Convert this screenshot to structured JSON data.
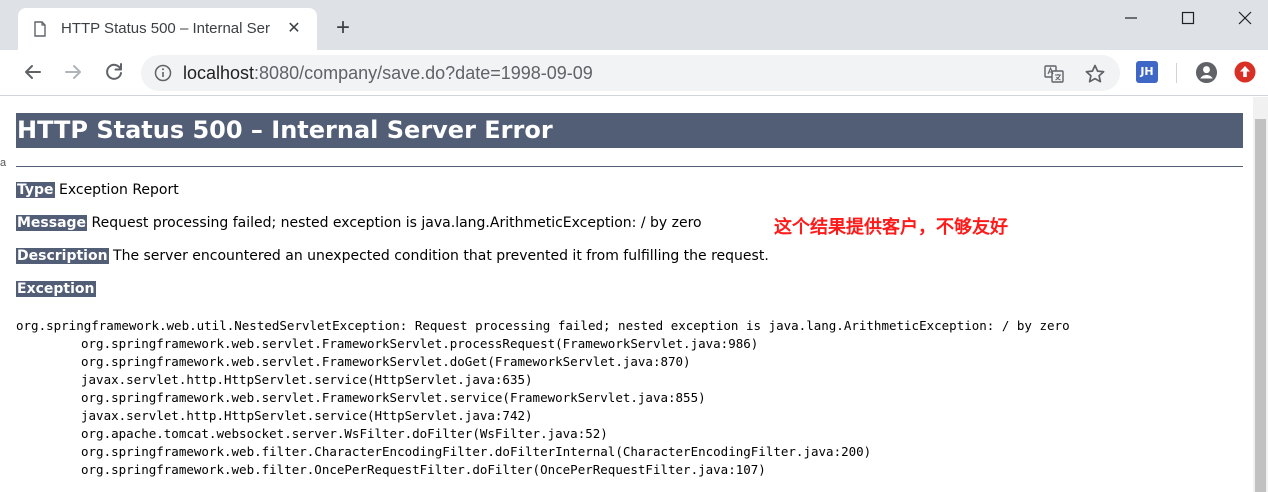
{
  "browser": {
    "tab": {
      "title": "HTTP Status 500 – Internal Ser",
      "icon": "document-icon"
    },
    "address": {
      "host": "localhost",
      "rest": ":8080/company/save.do?date=1998-09-09"
    },
    "extension_label": "JH"
  },
  "page": {
    "heading": "HTTP Status 500 – Internal Server Error",
    "type_label": "Type",
    "type_value": "Exception Report",
    "message_label": "Message",
    "message_value": "Request processing failed; nested exception is java.lang.ArithmeticException: / by zero",
    "description_label": "Description",
    "description_value": "The server encountered an unexpected condition that prevented it from fulfilling the request.",
    "exception_label": "Exception",
    "stack": [
      "org.springframework.web.util.NestedServletException: Request processing failed; nested exception is java.lang.ArithmeticException: / by zero",
      "org.springframework.web.servlet.FrameworkServlet.processRequest(FrameworkServlet.java:986)",
      "org.springframework.web.servlet.FrameworkServlet.doGet(FrameworkServlet.java:870)",
      "javax.servlet.http.HttpServlet.service(HttpServlet.java:635)",
      "org.springframework.web.servlet.FrameworkServlet.service(FrameworkServlet.java:855)",
      "javax.servlet.http.HttpServlet.service(HttpServlet.java:742)",
      "org.apache.tomcat.websocket.server.WsFilter.doFilter(WsFilter.java:52)",
      "org.springframework.web.filter.CharacterEncodingFilter.doFilterInternal(CharacterEncodingFilter.java:200)",
      "org.springframework.web.filter.OncePerRequestFilter.doFilter(OncePerRequestFilter.java:107)"
    ]
  },
  "annotation": "这个结果提供客户，不够友好",
  "colors": {
    "heading_bg": "#525d76",
    "annotation": "#ff1a1a",
    "tabstrip": "#dee1e6",
    "omnibox": "#f1f3f4"
  }
}
